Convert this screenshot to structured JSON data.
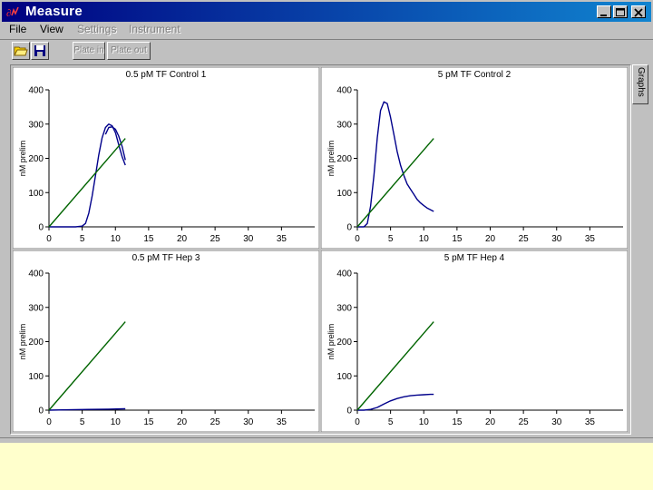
{
  "window": {
    "title": "Measure"
  },
  "menu": {
    "file": "File",
    "view": "View",
    "settings": "Settings",
    "instrument": "Instrument"
  },
  "toolbar": {
    "open_icon": "folder-open-icon",
    "save_icon": "floppy-disk-icon",
    "plate_in": "Plate in",
    "plate_out": "Plate out"
  },
  "side_tab": {
    "label": "Graphs"
  },
  "colors": {
    "measured": "#00008b",
    "fit": "#006400",
    "titlebar": "#000080",
    "background": "#ffffcc"
  },
  "chart_data": [
    {
      "type": "line",
      "title": "0.5 pM TF Control 1",
      "ylabel": "nM prelim",
      "xlim": [
        0,
        40
      ],
      "ylim": [
        0,
        400
      ],
      "xticks": [
        0,
        5,
        10,
        15,
        20,
        25,
        30,
        35
      ],
      "yticks": [
        0,
        100,
        200,
        300,
        400
      ],
      "series": [
        {
          "color": "#00008b",
          "x": [
            0,
            1,
            2,
            3,
            4,
            5,
            5.5,
            6,
            6.5,
            7,
            7.5,
            8,
            8.5,
            9,
            9.5,
            10,
            10.5,
            11,
            11.5
          ],
          "y": [
            0,
            0,
            0,
            0,
            0,
            2,
            10,
            40,
            90,
            150,
            210,
            260,
            290,
            300,
            295,
            275,
            240,
            205,
            180
          ]
        },
        {
          "color": "#00008b",
          "x": [
            8.5,
            9,
            9.5,
            10,
            10.5,
            11,
            11.5
          ],
          "y": [
            270,
            290,
            292,
            285,
            265,
            235,
            195
          ]
        },
        {
          "color": "#006400",
          "x": [
            0,
            11.5
          ],
          "y": [
            0,
            258
          ]
        }
      ]
    },
    {
      "type": "line",
      "title": "5 pM TF Control 2",
      "ylabel": "nM prelim",
      "xlim": [
        0,
        40
      ],
      "ylim": [
        0,
        400
      ],
      "xticks": [
        0,
        5,
        10,
        15,
        20,
        25,
        30,
        35
      ],
      "yticks": [
        0,
        100,
        200,
        300,
        400
      ],
      "series": [
        {
          "color": "#00008b",
          "x": [
            0,
            1,
            1.5,
            2,
            2.5,
            3,
            3.5,
            4,
            4.5,
            5,
            5.5,
            6,
            6.5,
            7,
            7.5,
            8,
            8.5,
            9,
            9.5,
            10,
            10.5,
            11,
            11.5
          ],
          "y": [
            0,
            0,
            10,
            60,
            150,
            260,
            340,
            365,
            360,
            320,
            270,
            220,
            180,
            150,
            125,
            110,
            95,
            80,
            70,
            62,
            55,
            50,
            45
          ]
        },
        {
          "color": "#006400",
          "x": [
            0,
            11.5
          ],
          "y": [
            0,
            258
          ]
        }
      ]
    },
    {
      "type": "line",
      "title": "0.5 pM TF Hep 3",
      "ylabel": "nM prelim",
      "xlim": [
        0,
        40
      ],
      "ylim": [
        0,
        400
      ],
      "xticks": [
        0,
        5,
        10,
        15,
        20,
        25,
        30,
        35
      ],
      "yticks": [
        0,
        100,
        200,
        300,
        400
      ],
      "series": [
        {
          "color": "#00008b",
          "x": [
            0,
            3,
            6,
            9,
            11.5
          ],
          "y": [
            0,
            1,
            2,
            3,
            4
          ]
        },
        {
          "color": "#006400",
          "x": [
            0,
            11.5
          ],
          "y": [
            0,
            258
          ]
        }
      ]
    },
    {
      "type": "line",
      "title": "5 pM TF Hep 4",
      "ylabel": "nM prelim",
      "xlim": [
        0,
        40
      ],
      "ylim": [
        0,
        400
      ],
      "xticks": [
        0,
        5,
        10,
        15,
        20,
        25,
        30,
        35
      ],
      "yticks": [
        0,
        100,
        200,
        300,
        400
      ],
      "series": [
        {
          "color": "#00008b",
          "x": [
            0,
            1,
            2,
            3,
            4,
            5,
            6,
            7,
            8,
            9,
            10,
            11,
            11.5
          ],
          "y": [
            0,
            0,
            2,
            8,
            18,
            27,
            34,
            39,
            42,
            44,
            45,
            46,
            46
          ]
        },
        {
          "color": "#006400",
          "x": [
            0,
            11.5
          ],
          "y": [
            0,
            258
          ]
        }
      ]
    }
  ]
}
